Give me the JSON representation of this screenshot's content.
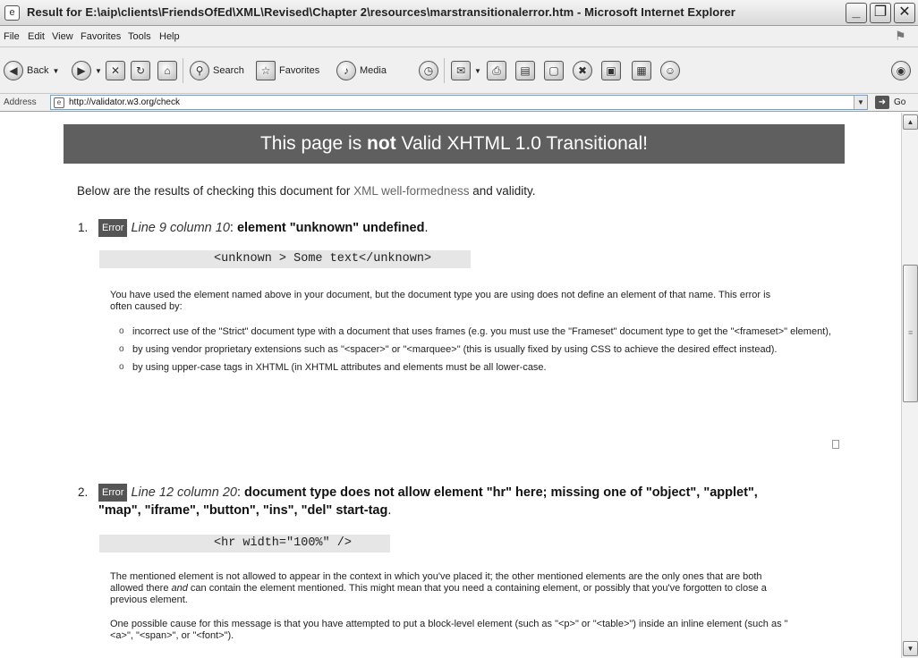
{
  "window": {
    "title": "Result for E:\\aip\\clients\\FriendsOfEd\\XML\\Revised\\Chapter 2\\resources\\marstransitionalerror.htm - Microsoft Internet Explorer",
    "min_glyph": "_",
    "max_glyph": "❐",
    "close_glyph": "✕"
  },
  "menu": [
    "File",
    "Edit",
    "View",
    "Favorites",
    "Tools",
    "Help"
  ],
  "toolbar": {
    "back": "Back",
    "search": "Search",
    "favorites": "Favorites",
    "media": "Media",
    "icons": [
      "back-icon",
      "forward-icon",
      "stop-icon",
      "refresh-icon",
      "home-icon",
      "search-icon",
      "favorites-icon",
      "media-icon",
      "history-icon",
      "mail-icon",
      "print-icon",
      "edit-icon",
      "discuss-icon",
      "messenger-icon",
      "research-icon",
      "collapse-icon",
      "contacts-icon"
    ]
  },
  "address": {
    "label": "Address",
    "url": "http://validator.w3.org/check",
    "go": "Go"
  },
  "page": {
    "banner_pre": "This page is ",
    "banner_bold": "not",
    "banner_post": " Valid XHTML 1.0 Transitional!",
    "intro_pre": "Below are the results of checking this document for ",
    "intro_link": "XML well-formedness",
    "intro_post": " and validity.",
    "errors": [
      {
        "num": "1.",
        "badge": "Error",
        "location": "Line 9 column 10",
        "message": "element \"unknown\" undefined",
        "code": "<unknown > Some text</unknown>",
        "para": "You have used the element named above in your document, but the document type you are using does not define an element of that name. This error is often caused by:",
        "bullets": [
          "incorrect use of the \"Strict\" document type with a document that uses frames (e.g. you must use the \"Frameset\" document type to get the \"<frameset>\" element),",
          "by using vendor proprietary extensions such as \"<spacer>\" or \"<marquee>\" (this is usually fixed by using CSS to achieve the desired effect instead).",
          "by using upper-case tags in XHTML (in XHTML attributes and elements must be all lower-case."
        ]
      },
      {
        "num": "2.",
        "badge": "Error",
        "location": "Line 12 column 20",
        "message_line1": "document type does not allow element \"hr\" here; missing one of \"object\", \"applet\",",
        "message_line2": "\"map\", \"iframe\", \"button\", \"ins\", \"del\" start-tag",
        "code": "<hr width=\"100%\" />",
        "para1_a": "The mentioned element is not allowed to appear in the context in which you've placed it; the other mentioned elements are the only ones that are both allowed there ",
        "para1_em": "and",
        "para1_b": " can contain the element mentioned. This might mean that you need a containing element, or possibly that you've forgotten to close a previous element.",
        "para2": "One possible cause for this message is that you have attempted to put a block-level element (such as \"<p>\" or \"<table>\") inside an inline element (such as \"<a>\", \"<span>\", or \"<font>\")."
      }
    ]
  }
}
